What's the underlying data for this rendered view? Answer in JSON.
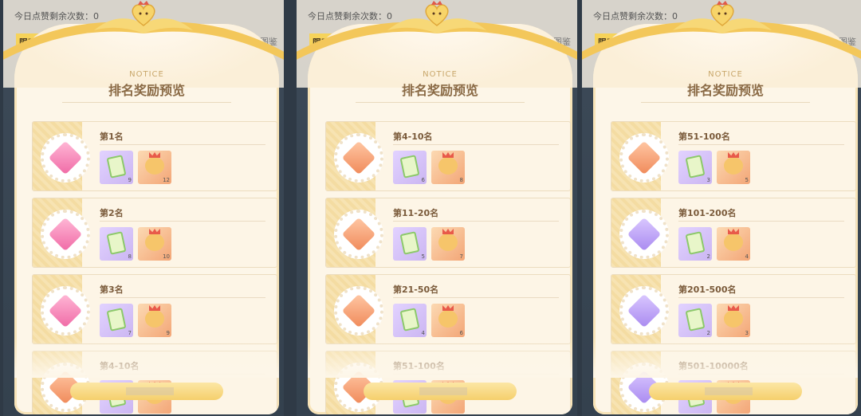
{
  "screens": [
    {
      "likes_text": "今日点赞剩余次数：0",
      "tag_text": "限时舞台",
      "corner_text": "图鉴",
      "notice": "NOTICE",
      "title": "排名奖励预览",
      "rows": [
        {
          "rank": "第1名",
          "gem": "pink",
          "card_count": "9",
          "bear_count": "12"
        },
        {
          "rank": "第2名",
          "gem": "pink",
          "card_count": "8",
          "bear_count": "10"
        },
        {
          "rank": "第3名",
          "gem": "pink",
          "card_count": "7",
          "bear_count": "9"
        },
        {
          "rank": "第4-10名",
          "gem": "orange",
          "card_count": "",
          "bear_count": ""
        }
      ]
    },
    {
      "likes_text": "今日点赞剩余次数：0",
      "tag_text": "限时舞台",
      "corner_text": "图鉴",
      "notice": "NOTICE",
      "title": "排名奖励预览",
      "rows": [
        {
          "rank": "第4-10名",
          "gem": "orange",
          "card_count": "6",
          "bear_count": "8"
        },
        {
          "rank": "第11-20名",
          "gem": "orange",
          "card_count": "5",
          "bear_count": "7"
        },
        {
          "rank": "第21-50名",
          "gem": "orange",
          "card_count": "4",
          "bear_count": "6"
        },
        {
          "rank": "第51-100名",
          "gem": "orange",
          "card_count": "",
          "bear_count": ""
        }
      ]
    },
    {
      "likes_text": "今日点赞剩余次数：0",
      "tag_text": "限时舞台",
      "corner_text": "图鉴",
      "notice": "NOTICE",
      "title": "排名奖励预览",
      "rows": [
        {
          "rank": "第51-100名",
          "gem": "orange",
          "card_count": "3",
          "bear_count": "5"
        },
        {
          "rank": "第101-200名",
          "gem": "purple",
          "card_count": "2",
          "bear_count": "4"
        },
        {
          "rank": "第201-500名",
          "gem": "purple",
          "card_count": "2",
          "bear_count": "3"
        },
        {
          "rank": "第501-10000名",
          "gem": "purple",
          "card_count": "",
          "bear_count": ""
        }
      ]
    }
  ],
  "colors": {
    "accent": "#f5cf6c",
    "title": "#8a6a45",
    "card_bg": "#fdf6e8"
  },
  "icons": {
    "gem": "diamond-gem-icon",
    "card": "clover-card-icon",
    "bear": "crown-bear-icon",
    "heart": "heart-crown-icon"
  }
}
